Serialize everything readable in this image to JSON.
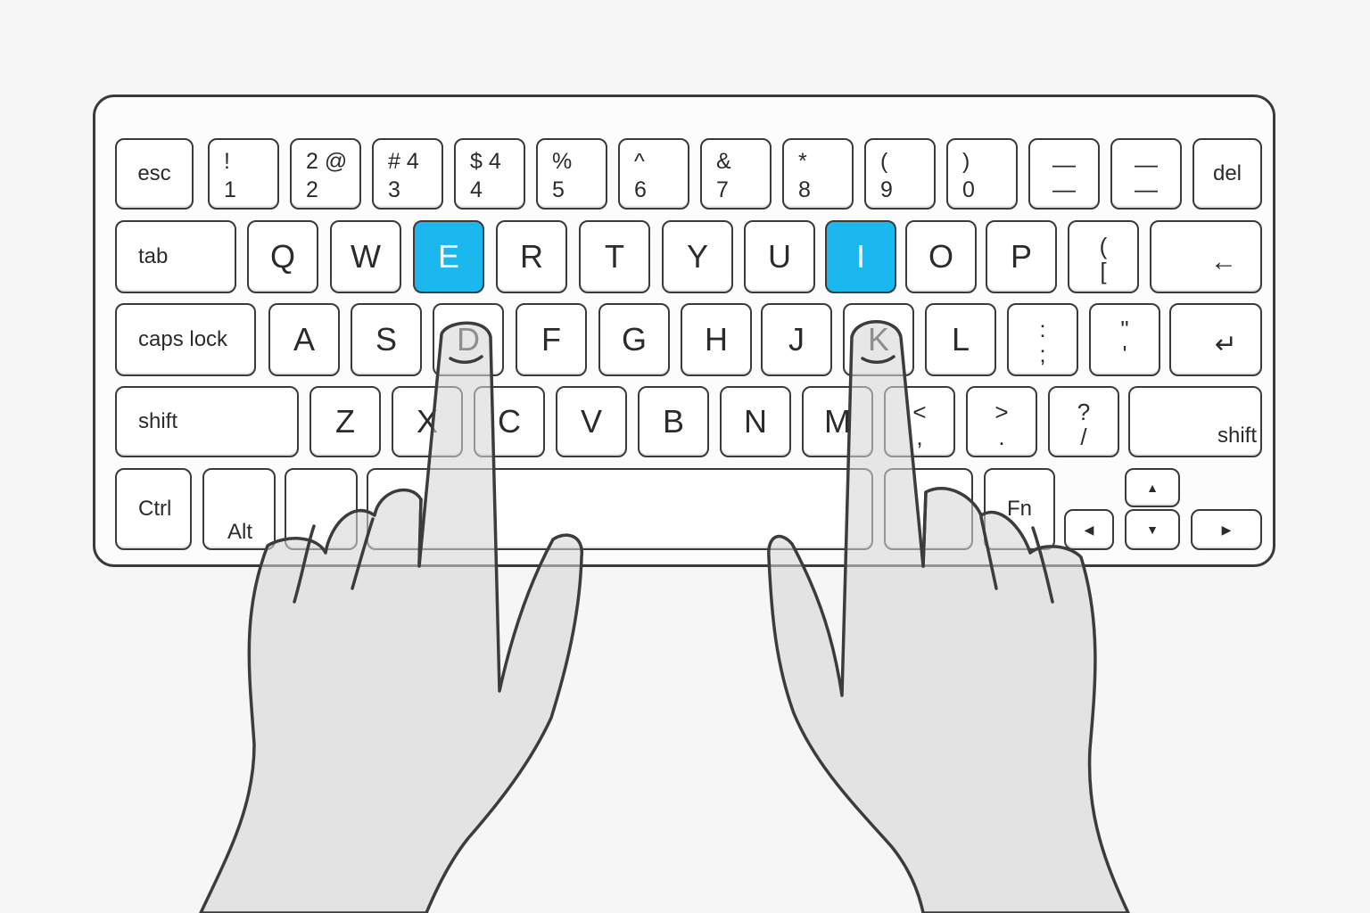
{
  "highlight_color": "#1bb7ef",
  "highlighted_keys": [
    "E",
    "I"
  ],
  "rows": {
    "number": [
      {
        "id": "esc",
        "word": "esc"
      },
      {
        "id": "1",
        "top": "!",
        "bot": "1"
      },
      {
        "id": "2",
        "top": "2 @",
        "bot": "2"
      },
      {
        "id": "3",
        "top": "# 4",
        "bot": "3"
      },
      {
        "id": "4",
        "top": "$ 4",
        "bot": "4"
      },
      {
        "id": "5",
        "top": "%",
        "bot": "5"
      },
      {
        "id": "6",
        "top": "^",
        "bot": "6"
      },
      {
        "id": "7",
        "top": "&",
        "bot": "7"
      },
      {
        "id": "8",
        "top": "*",
        "bot": "8"
      },
      {
        "id": "9",
        "top": "(",
        "bot": "9"
      },
      {
        "id": "0",
        "top": ")",
        "bot": "0"
      },
      {
        "id": "minus",
        "top": "—",
        "bot": "—"
      },
      {
        "id": "equals",
        "top": "—",
        "bot": "—"
      },
      {
        "id": "del",
        "word": "del"
      }
    ],
    "top": [
      {
        "id": "tab",
        "word": "tab"
      },
      {
        "id": "Q",
        "main": "Q"
      },
      {
        "id": "W",
        "main": "W"
      },
      {
        "id": "E",
        "main": "E"
      },
      {
        "id": "R",
        "main": "R"
      },
      {
        "id": "T",
        "main": "T"
      },
      {
        "id": "Y",
        "main": "Y"
      },
      {
        "id": "U",
        "main": "U"
      },
      {
        "id": "I",
        "main": "I"
      },
      {
        "id": "O",
        "main": "O"
      },
      {
        "id": "P",
        "main": "P"
      },
      {
        "id": "bracket",
        "top": "(",
        "bot": "["
      },
      {
        "id": "backspace",
        "icon": "←"
      }
    ],
    "home": [
      {
        "id": "caps",
        "word": "caps lock"
      },
      {
        "id": "A",
        "main": "A"
      },
      {
        "id": "S",
        "main": "S"
      },
      {
        "id": "D",
        "main": "D"
      },
      {
        "id": "F",
        "main": "F"
      },
      {
        "id": "G",
        "main": "G"
      },
      {
        "id": "H",
        "main": "H"
      },
      {
        "id": "J",
        "main": "J"
      },
      {
        "id": "K",
        "main": "K"
      },
      {
        "id": "L",
        "main": "L"
      },
      {
        "id": "semicolon",
        "top": ":",
        "bot": ";"
      },
      {
        "id": "quote",
        "top": "\"",
        "bot": "'"
      },
      {
        "id": "enter",
        "icon": "↵"
      }
    ],
    "bottom": [
      {
        "id": "lshift",
        "word": "shift"
      },
      {
        "id": "Z",
        "main": "Z"
      },
      {
        "id": "X",
        "main": "X"
      },
      {
        "id": "C",
        "main": "C"
      },
      {
        "id": "V",
        "main": "V"
      },
      {
        "id": "B",
        "main": "B"
      },
      {
        "id": "N",
        "main": "N"
      },
      {
        "id": "M",
        "main": "M"
      },
      {
        "id": "comma",
        "top": "<",
        "bot": ","
      },
      {
        "id": "period",
        "top": ">",
        "bot": "."
      },
      {
        "id": "slash",
        "top": "?",
        "bot": "/"
      },
      {
        "id": "rshift",
        "word": "shift"
      }
    ],
    "modifier": [
      {
        "id": "ctrl",
        "word": "Ctrl"
      },
      {
        "id": "alt",
        "word": "Alt"
      },
      {
        "id": "cmd-left",
        "word": ""
      },
      {
        "id": "space",
        "word": ""
      },
      {
        "id": "cmd-right",
        "word": ""
      },
      {
        "id": "fn",
        "word": "Fn"
      },
      {
        "id": "arrow-up",
        "icon": "▲"
      },
      {
        "id": "arrow-left",
        "icon": "◀"
      },
      {
        "id": "arrow-down",
        "icon": "▼"
      },
      {
        "id": "arrow-right",
        "icon": "▶"
      }
    ]
  }
}
